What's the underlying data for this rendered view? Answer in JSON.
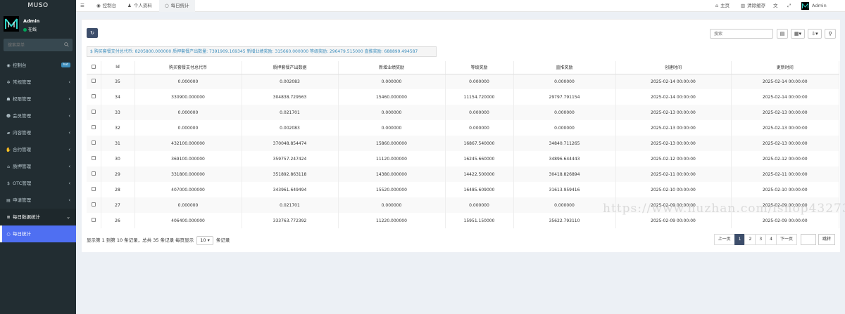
{
  "sidebar": {
    "logo": "MUSO",
    "user_name": "Admin",
    "user_status": "在线",
    "search_placeholder": "搜索菜单",
    "items": [
      {
        "label": "控制台",
        "badge": "hot"
      },
      {
        "label": "常规管理"
      },
      {
        "label": "权限管理"
      },
      {
        "label": "会员管理"
      },
      {
        "label": "内容管理"
      },
      {
        "label": "合约管理"
      },
      {
        "label": "质押管理"
      },
      {
        "label": "OTC管理"
      },
      {
        "label": "申请管理"
      },
      {
        "label": "每日数据统计"
      },
      {
        "label": "每日统计"
      }
    ]
  },
  "topbar": {
    "tabs": [
      "控制台",
      "个人资料",
      "每日统计"
    ],
    "home": "主页",
    "clear_cache": "清除缓存",
    "user": "Admin"
  },
  "toolbar": {
    "search_placeholder": "搜索"
  },
  "info_bar": "$ 购买套餐支付总代币: 8205800.000000 质押套餐产出数量: 7391909.169345 新增业绩奖励: 315660.000000 等级奖励: 296479.515000 直推奖励: 688899.494587",
  "table": {
    "headers": [
      "Id",
      "购买套餐支付总代币",
      "质押套餐产出数据",
      "新增业绩奖励",
      "等级奖励",
      "直推奖励",
      "创建时间",
      "更新时间"
    ],
    "rows": [
      [
        "35",
        "0.000000",
        "0.002083",
        "0.000000",
        "0.000000",
        "0.000000",
        "2025-02-14 00:00:00",
        "2025-02-14 00:00:00"
      ],
      [
        "34",
        "330900.000000",
        "304838.729563",
        "15460.000000",
        "11154.720000",
        "29797.791154",
        "2025-02-14 00:00:00",
        "2025-02-14 00:00:00"
      ],
      [
        "33",
        "0.000000",
        "0.021701",
        "0.000000",
        "0.000000",
        "0.000000",
        "2025-02-13 00:00:00",
        "2025-02-13 00:00:00"
      ],
      [
        "32",
        "0.000000",
        "0.002083",
        "0.000000",
        "0.000000",
        "0.000000",
        "2025-02-13 00:00:00",
        "2025-02-13 00:00:00"
      ],
      [
        "31",
        "432100.000000",
        "370048.854474",
        "15860.000000",
        "16867.540000",
        "34840.711265",
        "2025-02-13 00:00:00",
        "2025-02-13 00:00:00"
      ],
      [
        "30",
        "369100.000000",
        "359757.247424",
        "11120.000000",
        "16245.660000",
        "34896.644443",
        "2025-02-12 00:00:00",
        "2025-02-12 00:00:00"
      ],
      [
        "29",
        "331800.000000",
        "351892.863118",
        "14380.000000",
        "14422.500000",
        "30418.826894",
        "2025-02-11 00:00:00",
        "2025-02-11 00:00:00"
      ],
      [
        "28",
        "407000.000000",
        "343961.649494",
        "15520.000000",
        "16485.609000",
        "31613.959416",
        "2025-02-10 00:00:00",
        "2025-02-10 00:00:00"
      ],
      [
        "27",
        "0.000000",
        "0.021701",
        "0.000000",
        "0.000000",
        "0.000000",
        "2025-02-09 00:00:00",
        "2025-02-09 00:00:00"
      ],
      [
        "26",
        "406400.000000",
        "333763.772392",
        "11220.000000",
        "15951.150000",
        "35622.793110",
        "2025-02-09 00:00:00",
        "2025-02-09 00:00:00"
      ]
    ]
  },
  "footer": {
    "prefix": "显示第 1 到第 10 条记录，总共 35 条记录 每页显示",
    "page_size": "10",
    "suffix": "条记录"
  },
  "pagination": {
    "prev": "上一页",
    "pages": [
      "1",
      "2",
      "3",
      "4"
    ],
    "next": "下一页",
    "go": "跳转"
  },
  "watermark": "https://www.huzhan.com/ishop43273",
  "colors": {
    "sidebar": "#222d32",
    "accent": "#4f6ff2",
    "primary_btn": "#3d4e6b"
  }
}
